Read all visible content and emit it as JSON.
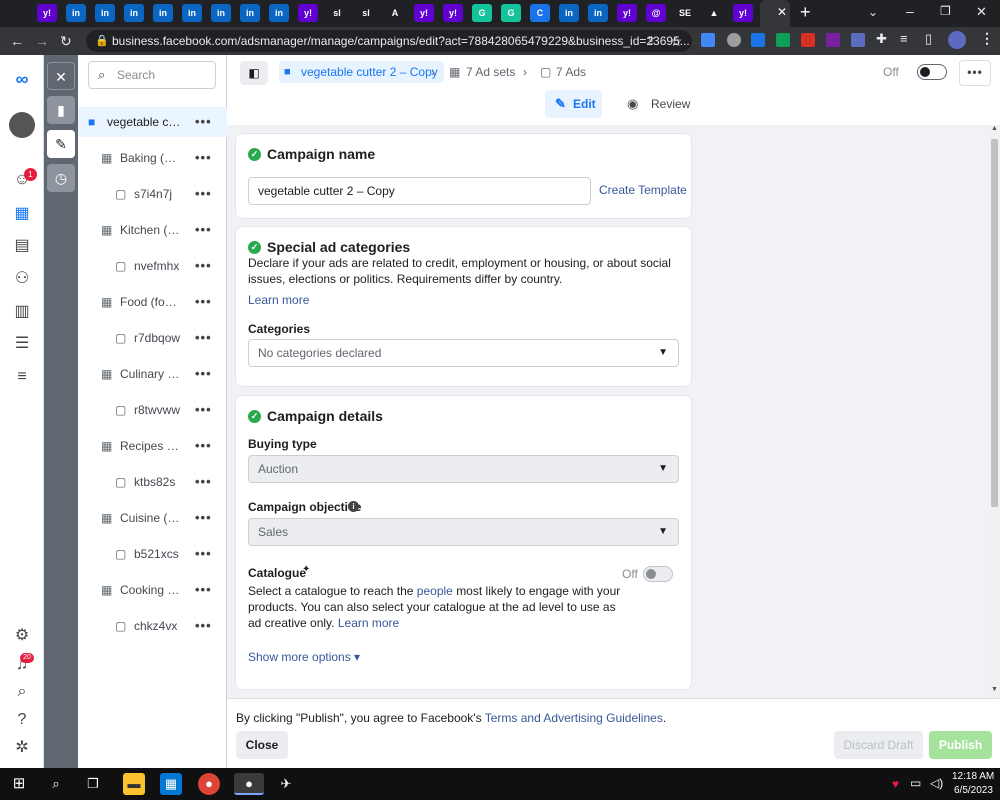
{
  "browser": {
    "url": "business.facebook.com/adsmanager/manage/campaigns/edit?act=788428065479229&business_id=23695...",
    "tabs": [
      {
        "label": "y!",
        "color": "#6001d2"
      },
      {
        "label": "in",
        "color": "#0a66c2"
      },
      {
        "label": "in",
        "color": "#0a66c2"
      },
      {
        "label": "in",
        "color": "#0a66c2"
      },
      {
        "label": "in",
        "color": "#0a66c2"
      },
      {
        "label": "in",
        "color": "#0a66c2"
      },
      {
        "label": "in",
        "color": "#0a66c2"
      },
      {
        "label": "in",
        "color": "#0a66c2"
      },
      {
        "label": "in",
        "color": "#0a66c2"
      },
      {
        "label": "y!",
        "color": "#6001d2"
      },
      {
        "label": "sl",
        "color": "#202124"
      },
      {
        "label": "sl",
        "color": "#202124"
      },
      {
        "label": "A",
        "color": "#202124"
      },
      {
        "label": "y!",
        "color": "#6001d2"
      },
      {
        "label": "y!",
        "color": "#6001d2"
      },
      {
        "label": "G",
        "color": "#15c39a"
      },
      {
        "label": "G",
        "color": "#15c39a"
      },
      {
        "label": "C",
        "color": "#1a73e8"
      },
      {
        "label": "in",
        "color": "#0a66c2"
      },
      {
        "label": "in",
        "color": "#0a66c2"
      },
      {
        "label": "y!",
        "color": "#6001d2"
      },
      {
        "label": "@",
        "color": "#6001d2"
      },
      {
        "label": "SE",
        "color": "#202124"
      },
      {
        "label": "▲",
        "color": "#202124"
      },
      {
        "label": "y!",
        "color": "#6001d2"
      }
    ]
  },
  "search": {
    "placeholder": "Search"
  },
  "tree": [
    {
      "label": "vegetable cut...",
      "level": 0,
      "selected": true
    },
    {
      "label": "Baking (co...",
      "level": 1
    },
    {
      "label": "s7i4n7j",
      "level": 2
    },
    {
      "label": "Kitchen (h...",
      "level": 1
    },
    {
      "label": "nvefmhx",
      "level": 2
    },
    {
      "label": "Food (food...",
      "level": 1
    },
    {
      "label": "r7dbqow",
      "level": 2
    },
    {
      "label": "Culinary ar...",
      "level": 1
    },
    {
      "label": "r8twvww",
      "level": 2
    },
    {
      "label": "Recipes (f...",
      "level": 1
    },
    {
      "label": "ktbs82s",
      "level": 2
    },
    {
      "label": "Cuisine (fo...",
      "level": 1
    },
    {
      "label": "b521xcs",
      "level": 2
    },
    {
      "label": "Cooking (f...",
      "level": 1
    },
    {
      "label": "chkz4vx",
      "level": 2
    }
  ],
  "rail": {
    "notif_badge": "1",
    "bell_badge": "20"
  },
  "header": {
    "campaign": "vegetable cutter 2 – Copy",
    "adsets": "7 Ad sets",
    "ads": "7 Ads",
    "edit": "Edit",
    "review": "Review",
    "off": "Off",
    "more": "•••"
  },
  "campaign_name": {
    "title": "Campaign name",
    "value": "vegetable cutter 2 – Copy",
    "create_template": "Create Template"
  },
  "special": {
    "title": "Special ad categories",
    "desc": "Declare if your ads are related to credit, employment or housing, or about social issues, elections or politics. Requirements differ by country.",
    "learn_more": "Learn more",
    "categories_label": "Categories",
    "categories_placeholder": "No categories declared"
  },
  "details": {
    "title": "Campaign details",
    "buying_type_label": "Buying type",
    "buying_type": "Auction",
    "objective_label": "Campaign objective",
    "objective": "Sales",
    "catalogue_label": "Catalogue",
    "catalogue_off": "Off",
    "catalogue_desc_1": "Select a catalogue to reach the",
    "catalogue_people": "people",
    "catalogue_desc_2": "most likely to engage with your products. You can also select your catalogue at the ad level to use as ad creative only.",
    "learn_more": "Learn more",
    "show_more": "Show more options ▾"
  },
  "footer": {
    "notice_1": "By clicking \"Publish\", you agree to Facebook's",
    "terms_link": "Terms and Advertising Guidelines",
    "close": "Close",
    "discard": "Discard Draft",
    "publish": "Publish"
  },
  "taskbar": {
    "time": "12:18 AM",
    "date": "6/5/2023"
  }
}
